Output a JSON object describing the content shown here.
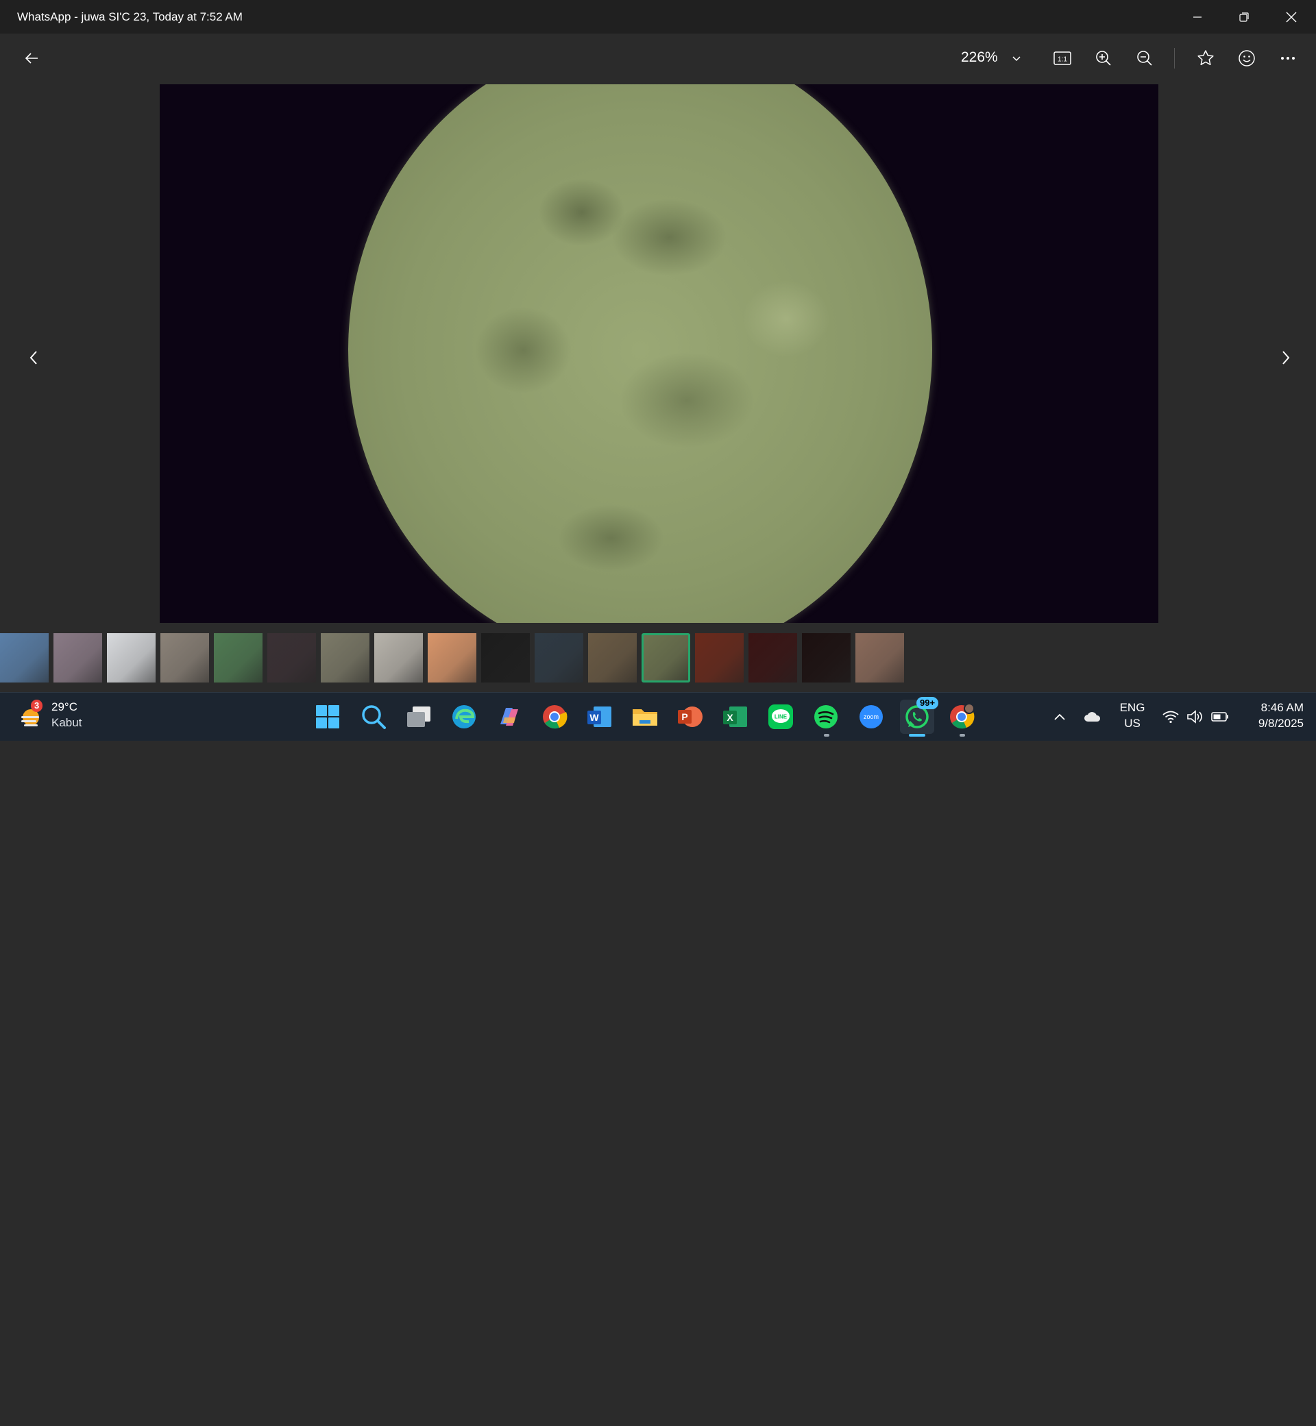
{
  "window": {
    "title": "WhatsApp - juwa SI'C 23, Today at 7:52 AM",
    "minimize_icon": "minimize-icon",
    "restore_icon": "restore-icon",
    "close_icon": "close-icon"
  },
  "toolbar": {
    "back_icon": "back-arrow-icon",
    "zoom_level": "226%",
    "zoom_dropdown_icon": "chevron-down-icon",
    "actual_size_label": "1:1",
    "zoom_in_icon": "zoom-in-icon",
    "zoom_out_icon": "zoom-out-icon",
    "favorite_icon": "star-icon",
    "emoji_icon": "smiley-icon",
    "more_icon": "more-icon"
  },
  "viewer": {
    "image_subject": "full moon",
    "prev_icon": "chevron-left-icon",
    "next_icon": "chevron-right-icon"
  },
  "filmstrip": {
    "thumbnails": [
      {
        "color": "#5a7fa8"
      },
      {
        "color": "#8a7a86"
      },
      {
        "color": "#d8dadd"
      },
      {
        "color": "#8b8278"
      },
      {
        "color": "#4f7a52"
      },
      {
        "color": "#3a3034"
      },
      {
        "color": "#7c7a68"
      },
      {
        "color": "#b8b4ac"
      },
      {
        "color": "#d8956a"
      },
      {
        "color": "#1c1c1c"
      },
      {
        "color": "#2f3a44"
      },
      {
        "color": "#6a5a44"
      },
      {
        "color": "#6d7450",
        "active": true
      },
      {
        "color": "#6a2a1c"
      },
      {
        "color": "#3a1414"
      },
      {
        "color": "#1c1010"
      },
      {
        "color": "#8a6a5a"
      }
    ]
  },
  "taskbar": {
    "weather": {
      "temp": "29°C",
      "desc": "Kabut",
      "badge": "3",
      "icon": "weather-haze-icon"
    },
    "apps": [
      {
        "name": "start",
        "icon": "windows-start-icon"
      },
      {
        "name": "search",
        "icon": "search-icon"
      },
      {
        "name": "task-view",
        "icon": "task-view-icon"
      },
      {
        "name": "edge",
        "icon": "edge-icon"
      },
      {
        "name": "copilot",
        "icon": "copilot-icon"
      },
      {
        "name": "chrome",
        "icon": "chrome-icon"
      },
      {
        "name": "word",
        "icon": "word-icon",
        "letter": "W"
      },
      {
        "name": "file-explorer",
        "icon": "folder-icon"
      },
      {
        "name": "powerpoint",
        "icon": "powerpoint-icon",
        "letter": "P"
      },
      {
        "name": "excel",
        "icon": "excel-icon",
        "letter": "X"
      },
      {
        "name": "line",
        "icon": "line-icon",
        "letter": "LINE"
      },
      {
        "name": "spotify",
        "icon": "spotify-icon"
      },
      {
        "name": "zoom",
        "icon": "zoom-icon",
        "letter": "zoom"
      },
      {
        "name": "whatsapp",
        "icon": "whatsapp-icon",
        "badge": "99+"
      },
      {
        "name": "chrome-profile",
        "icon": "chrome-icon"
      }
    ],
    "tray": {
      "overflow_icon": "chevron-up-icon",
      "onedrive_icon": "cloud-icon",
      "lang_line1": "ENG",
      "lang_line2": "US",
      "wifi_icon": "wifi-icon",
      "volume_icon": "volume-icon",
      "battery_icon": "battery-icon",
      "time": "8:46 AM",
      "date": "9/8/2025"
    }
  }
}
